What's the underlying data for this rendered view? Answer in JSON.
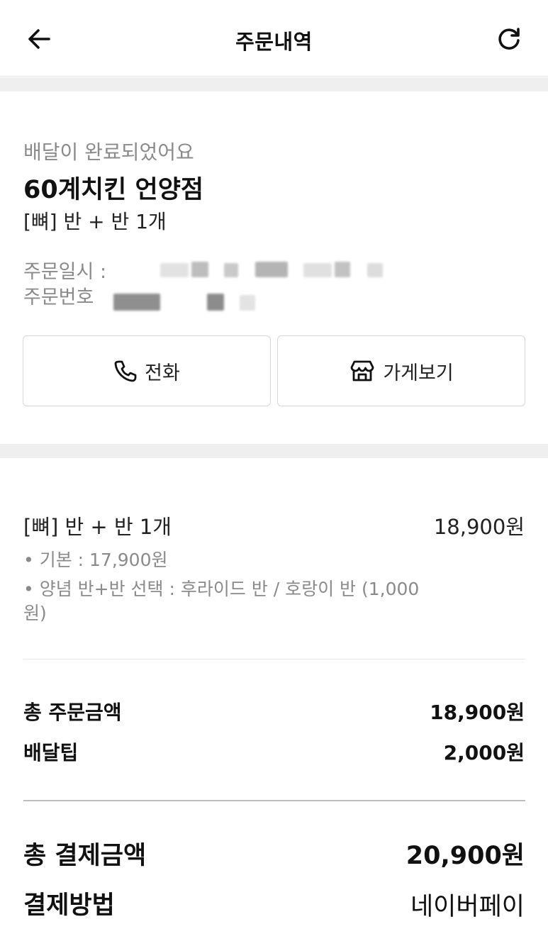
{
  "header": {
    "title": "주문내역",
    "back_icon": "arrow-left-icon",
    "refresh_icon": "refresh-icon"
  },
  "order": {
    "status": "배달이 완료되었어요",
    "store_name": "60계치킨 언양점",
    "summary": "[뼈] 반 + 반 1개",
    "date_label": "주문일시 :",
    "number_label": "주문번호"
  },
  "actions": {
    "call_label": "전화",
    "call_icon": "phone-icon",
    "store_label": "가게보기",
    "store_icon": "store-icon"
  },
  "item": {
    "name": "[뼈] 반 + 반 1개",
    "price": "18,900원",
    "options": [
      "• 기본 : 17,900원",
      "• 양념 반+반 선택 : 후라이드 반 / 호랑이 반 (1,000원)"
    ]
  },
  "totals": {
    "order_total_label": "총 주문금액",
    "order_total_value": "18,900원",
    "delivery_tip_label": "배달팁",
    "delivery_tip_value": "2,000원",
    "payment_total_label": "총 결제금액",
    "payment_total_value": "20,900원",
    "payment_method_label": "결제방법",
    "payment_method_value": "네이버페이"
  }
}
